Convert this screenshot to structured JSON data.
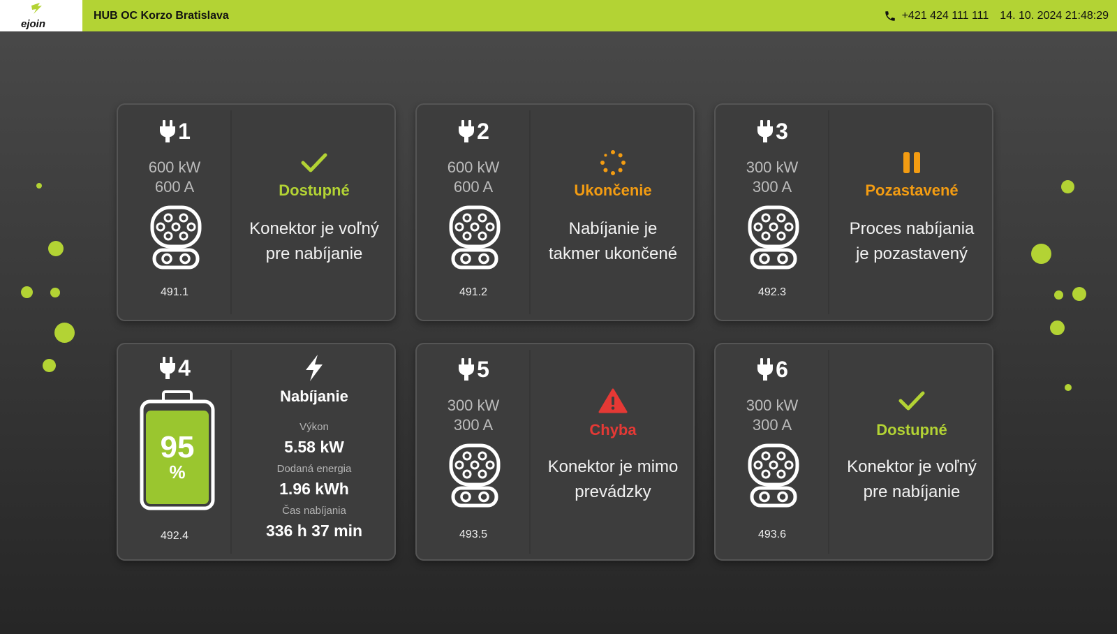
{
  "header": {
    "logo_text": "ejoin",
    "station_name": "HUB OC Korzo Bratislava",
    "phone": "+421 424 111 111",
    "datetime": "14. 10. 2024 21:48:29"
  },
  "colors": {
    "brand_green": "#b3d334",
    "status_available": "#b3d334",
    "status_finishing": "#f39c12",
    "status_paused": "#f39c12",
    "status_error": "#e53935"
  },
  "connectors": [
    {
      "number": "1",
      "power": "600 kW",
      "current": "600 A",
      "code": "491.1",
      "status_icon": "check-icon",
      "status": "Dostupné",
      "message_line1": "Konektor je voľný",
      "message_line2": "pre nabíjanie"
    },
    {
      "number": "2",
      "power": "600 kW",
      "current": "600 A",
      "code": "491.2",
      "status_icon": "spinner-icon",
      "status": "Ukončenie",
      "message_line1": "Nabíjanie je",
      "message_line2": "takmer ukončené"
    },
    {
      "number": "3",
      "power": "300 kW",
      "current": "300 A",
      "code": "492.3",
      "status_icon": "pause-icon",
      "status": "Pozastavené",
      "message_line1": "Proces nabíjania",
      "message_line2": "je pozastavený"
    },
    {
      "number": "4",
      "code": "492.4",
      "battery_value": "95",
      "battery_unit": "%",
      "battery_level": 0.95,
      "status_icon": "lightning-icon",
      "status": "Nabíjanie",
      "metrics": {
        "power_label": "Výkon",
        "power_value": "5.58 kW",
        "energy_label": "Dodaná energia",
        "energy_value": "1.96 kWh",
        "time_label": "Čas nabíjania",
        "time_value": "336 h 37 min"
      }
    },
    {
      "number": "5",
      "power": "300 kW",
      "current": "300 A",
      "code": "493.5",
      "status_icon": "warning-icon",
      "status": "Chyba",
      "message_line1": "Konektor je mimo",
      "message_line2": "prevádzky"
    },
    {
      "number": "6",
      "power": "300 kW",
      "current": "300 A",
      "code": "493.6",
      "status_icon": "check-icon",
      "status": "Dostupné",
      "message_line1": "Konektor je voľný",
      "message_line2": "pre nabíjanie"
    }
  ]
}
